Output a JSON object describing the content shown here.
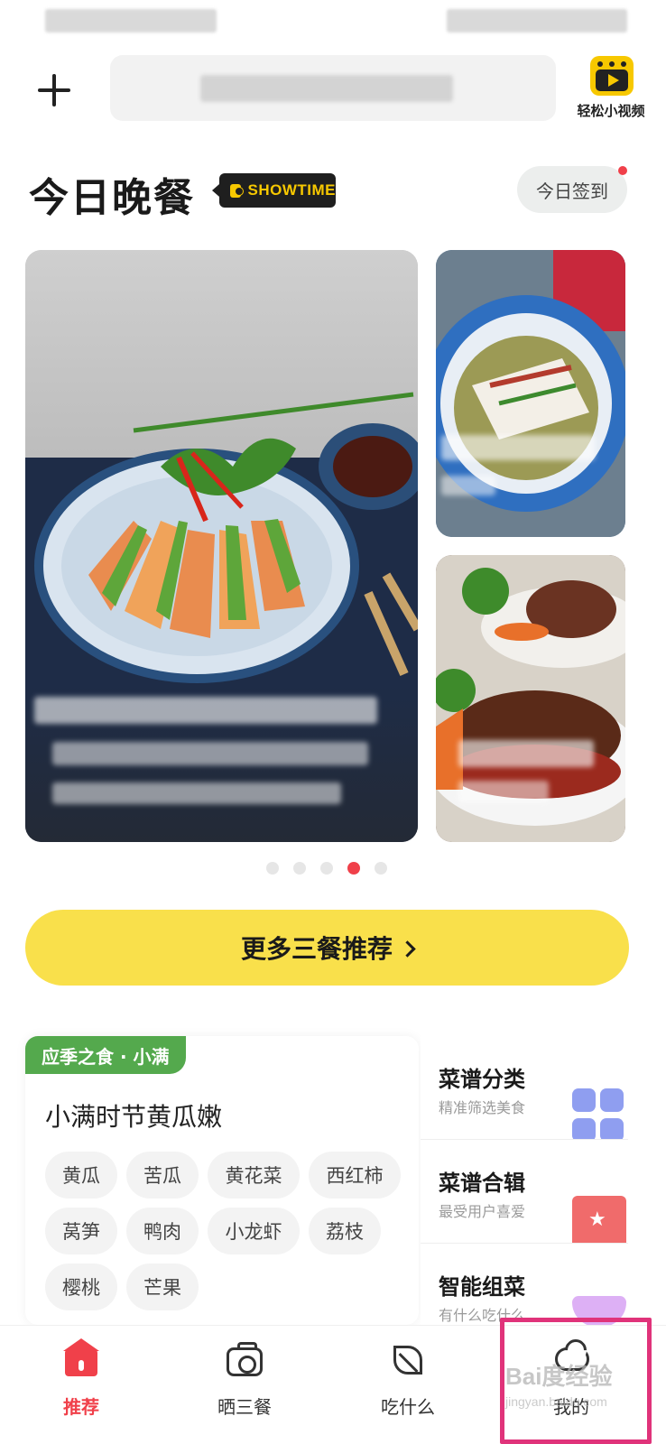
{
  "top_bar": {
    "video_label": "轻松小视频"
  },
  "header": {
    "title": "今日晚餐",
    "badge_text": "SHOWTIME",
    "checkin_label": "今日签到"
  },
  "carousel": {
    "total_dots": 5,
    "active_dot": 4
  },
  "more_button": {
    "label": "更多三餐推荐"
  },
  "seasonal": {
    "tag": "应季之食 · 小满",
    "title": "小满时节黄瓜嫩",
    "chips": [
      "黄瓜",
      "苦瓜",
      "黄花菜",
      "西红柿",
      "莴笋",
      "鸭肉",
      "小龙虾",
      "荔枝",
      "樱桃",
      "芒果"
    ]
  },
  "side_menu": [
    {
      "title": "菜谱分类",
      "subtitle": "精准筛选美食"
    },
    {
      "title": "菜谱合辑",
      "subtitle": "最受用户喜爱"
    },
    {
      "title": "智能组菜",
      "subtitle": "有什么吃什么"
    }
  ],
  "bottom_nav": [
    {
      "label": "推荐",
      "icon": "home-icon",
      "active": true
    },
    {
      "label": "晒三餐",
      "icon": "camera-icon",
      "active": false
    },
    {
      "label": "吃什么",
      "icon": "leaf-icon",
      "active": false
    },
    {
      "label": "我的",
      "icon": "cloud-profile-icon",
      "active": false
    }
  ],
  "watermark": {
    "text": "Bai度经验",
    "sub": "jingyan.baidu.com"
  },
  "colors": {
    "accent_red": "#f0404a",
    "brand_yellow": "#f9e04b",
    "season_green": "#54a94d",
    "highlight_pink": "#e0337a"
  }
}
